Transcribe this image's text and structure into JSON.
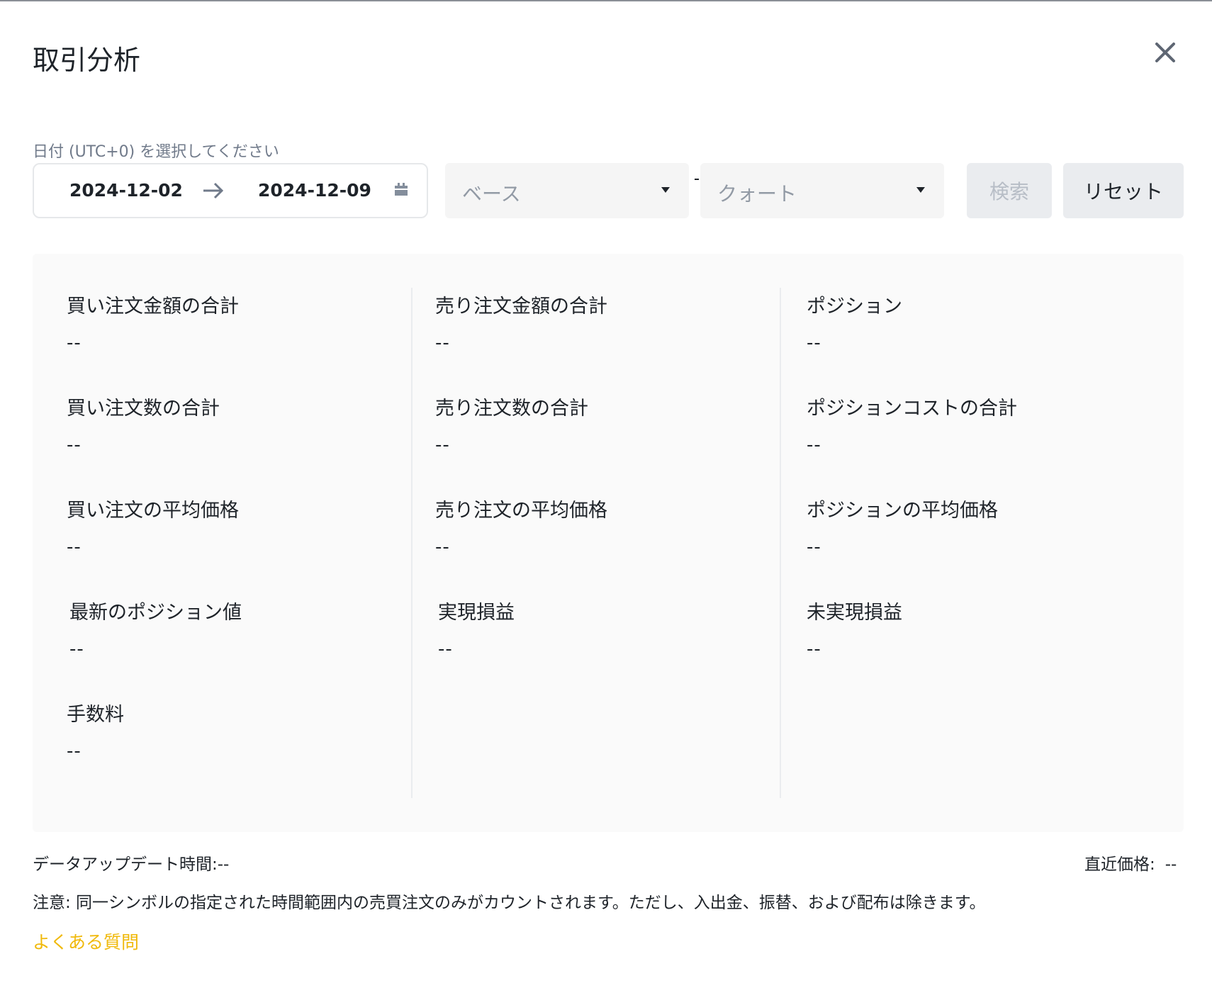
{
  "modal": {
    "title": "取引分析"
  },
  "filters": {
    "date_label": "日付 (UTC+0) を選択してください",
    "date_start": "2024-12-02",
    "date_end": "2024-12-09",
    "base_placeholder": "ベース",
    "quote_placeholder": "クォート",
    "search_label": "検索",
    "reset_label": "リセット"
  },
  "stats": {
    "col1": [
      {
        "label": "買い注文金額の合計",
        "value": "--"
      },
      {
        "label": "買い注文数の合計",
        "value": "--"
      },
      {
        "label": "買い注文の平均価格",
        "value": "--"
      },
      {
        "label": "最新のポジション値",
        "value": "--"
      },
      {
        "label": "手数料",
        "value": "--"
      }
    ],
    "col2": [
      {
        "label": "売り注文金額の合計",
        "value": "--"
      },
      {
        "label": "売り注文数の合計",
        "value": "--"
      },
      {
        "label": "売り注文の平均価格",
        "value": "--"
      },
      {
        "label": "実現損益",
        "value": "--"
      }
    ],
    "col3": [
      {
        "label": "ポジション",
        "value": "--"
      },
      {
        "label": "ポジションコストの合計",
        "value": "--"
      },
      {
        "label": "ポジションの平均価格",
        "value": "--"
      },
      {
        "label": "未実現損益",
        "value": "--"
      }
    ]
  },
  "footer": {
    "update_time": "データアップデート時間:--",
    "last_price_label": "直近価格:",
    "last_price_value": "--",
    "note": "注意: 同一シンボルの指定された時間範囲内の売買注文のみがカウントされます。ただし、入出金、振替、および配布は除きます。",
    "faq_label": "よくある質問"
  },
  "colors": {
    "accent": "#f0b90b",
    "text": "#1e2329",
    "muted": "#707a8a",
    "panel_bg": "#fafafa"
  },
  "icons": {
    "close": "close-icon",
    "arrow": "arrow-right-icon",
    "calendar": "calendar-icon",
    "caret": "caret-down-icon"
  }
}
